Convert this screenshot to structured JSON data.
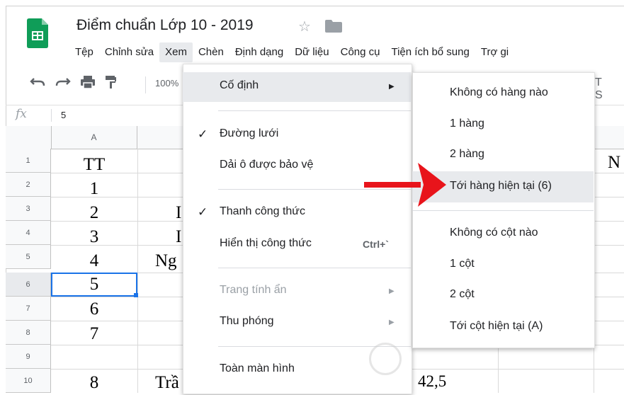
{
  "window": {
    "title": "Điểm chuẩn Lớp 10 - 2019"
  },
  "menubar": [
    "Tệp",
    "Chỉnh sửa",
    "Xem",
    "Chèn",
    "Định dạng",
    "Dữ liệu",
    "Công cụ",
    "Tiện ích bổ sung",
    "Trợ gi"
  ],
  "toolbar": {
    "zoom": "100%"
  },
  "formula_bar": {
    "fx": "fx",
    "value": "5"
  },
  "grid": {
    "col_a_header": "A",
    "rows": [
      "1",
      "2",
      "3",
      "4",
      "5",
      "6",
      "7",
      "8",
      "9",
      "10"
    ],
    "col_a": [
      "TT",
      "1",
      "2",
      "3",
      "4",
      "5",
      "6",
      "7",
      "",
      "8"
    ],
    "col_b": [
      "",
      "",
      "I",
      "I",
      "Ng",
      "",
      "",
      "",
      "",
      "Trầ"
    ],
    "extra": {
      "n_text": "N",
      "score": "42,5"
    }
  },
  "view_menu": {
    "freeze": "Cố định",
    "gridlines": "Đường lưới",
    "protected": "Dải ô được bảo vệ",
    "formula_bar": "Thanh công thức",
    "show_formulas": "Hiển thị công thức",
    "show_formulas_shortcut": "Ctrl+`",
    "hidden_sheets": "Trang tính ẩn",
    "zoom": "Thu phóng",
    "fullscreen": "Toàn màn hình",
    "check": "✓"
  },
  "freeze_submenu": {
    "no_rows": "Không có hàng nào",
    "row1": "1 hàng",
    "row2": "2 hàng",
    "to_current_row": "Tới hàng hiện tại (6)",
    "no_cols": "Không có cột nào",
    "col1": "1 cột",
    "col2": "2 cột",
    "to_current_col": "Tới cột hiện tại (A)"
  },
  "colors": {
    "accent": "#1a73e8",
    "sheets_green": "#0f9d58",
    "arrow_red": "#e8141b",
    "highlight": "#e8eaed"
  },
  "icons": [
    "undo-icon",
    "redo-icon",
    "print-icon",
    "paint-format-icon",
    "star-icon",
    "folder-icon",
    "sheets-logo-icon",
    "submenu-arrow-icon"
  ]
}
